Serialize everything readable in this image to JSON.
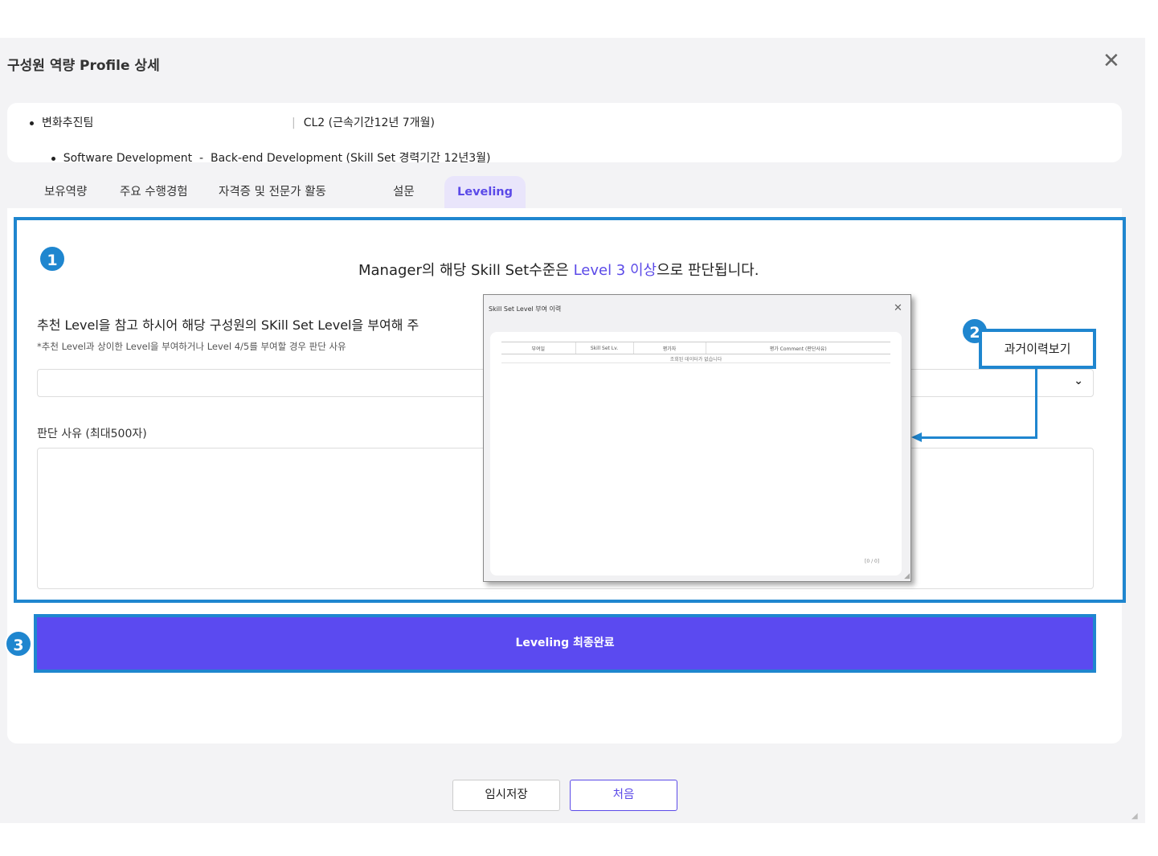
{
  "dialog": {
    "title": "구성원 역량 Profile 상세",
    "close": "✕"
  },
  "info": {
    "line1_team": "변화추진팀",
    "line1_cl": "CL2 (근속기간12년 7개월)",
    "line2": "Software Development  -  Back-end Development (Skill Set 경력기간 12년3월)"
  },
  "tabs": [
    "보유역량",
    "주요 수행경험",
    "자격증 및 전문가 활동",
    "설문",
    "Leveling"
  ],
  "leveling": {
    "judge_prefix": "Manager의 해당 Skill Set수준은 ",
    "judge_level": "Level 3 이상",
    "judge_suffix": "으로 판단됩니다.",
    "rec_title": "추천 Level을 참고 하시어 해당 구성원의 SKill Set Level을 부여해 주",
    "rec_note": "*추천 Level과 상이한 Level을 부여하거나 Level 4/5를 부여할 경우 판단 사유 ",
    "select_value": "",
    "reason_label": "판단 사유 (최대500자)",
    "history_button": "과거이력보기",
    "final_button": "Leveling 최종완료"
  },
  "popup": {
    "title": "Skill Set Level 부여 이력",
    "close": "✕",
    "columns": [
      "부여일",
      "Skill Set Lv.",
      "평가자",
      "평가 Comment (판단사유)"
    ],
    "empty_message": "조회된 데이터가 없습니다",
    "count": "[0 / 0]"
  },
  "badges": [
    "1",
    "2",
    "3"
  ],
  "footer": {
    "save": "임시저장",
    "first": "처음"
  },
  "colors": {
    "accent": "#5b4ae8",
    "highlight": "#1f86cf",
    "primary_button": "#5b4af0"
  }
}
